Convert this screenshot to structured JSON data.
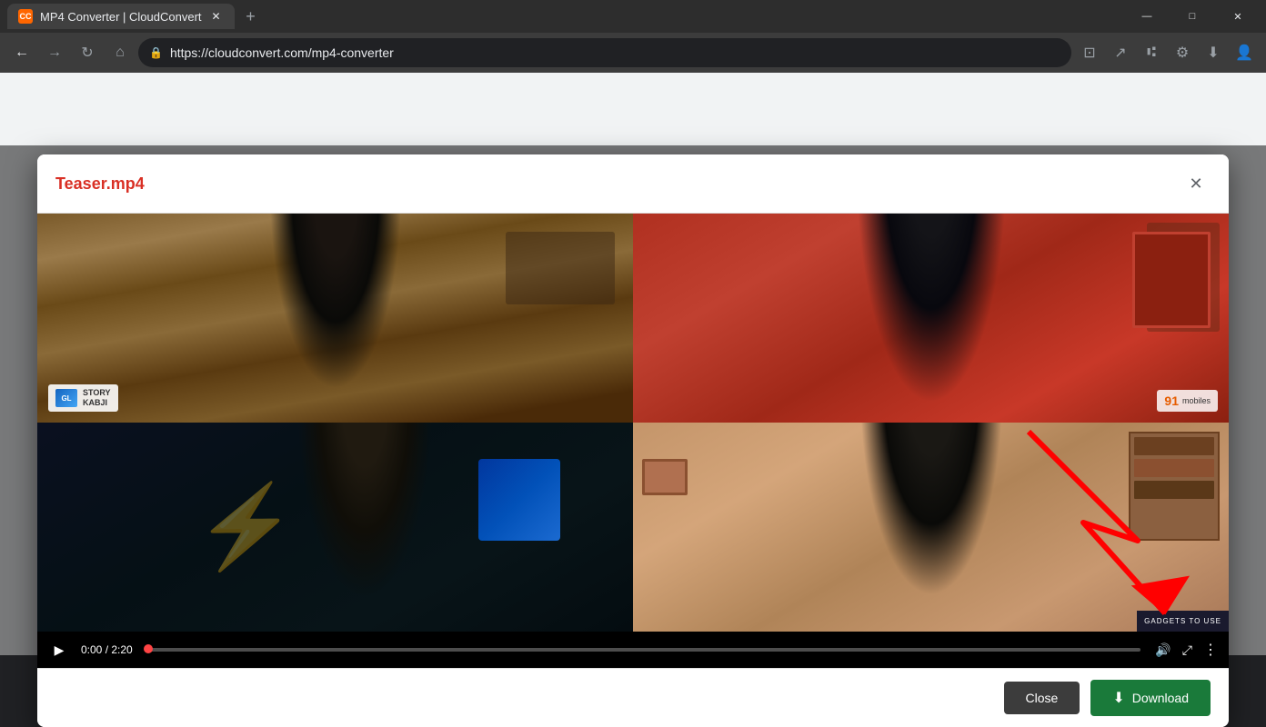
{
  "browser": {
    "tab": {
      "title": "MP4 Converter | CloudConvert",
      "favicon": "CC"
    },
    "address": "https://cloudconvert.com/mp4-converter",
    "window_controls": {
      "minimize": "—",
      "maximize": "□",
      "close": "✕"
    }
  },
  "modal": {
    "title": "Teaser.mp4",
    "close_label": "✕",
    "video": {
      "time_current": "0:00",
      "time_total": "2:20",
      "time_display": "0:00 / 2:20"
    },
    "footer": {
      "close_label": "Close",
      "download_label": "Download",
      "download_icon": "⬇"
    }
  },
  "watermarks": {
    "top_left": {
      "logo_text": "GL",
      "name_line1": "STORY",
      "name_line2": "KABJI"
    },
    "top_right": {
      "number": "91",
      "name": "mobiles"
    },
    "bottom_right": {
      "name": "GADGETS TO USE"
    }
  },
  "icons": {
    "play": "▶",
    "volume": "🔊",
    "fullscreen": "⤢",
    "more_options": "⋮",
    "lock": "🔒",
    "back": "←",
    "forward": "→",
    "refresh": "↻",
    "home": "⌂",
    "download_cloud": "⬇"
  }
}
